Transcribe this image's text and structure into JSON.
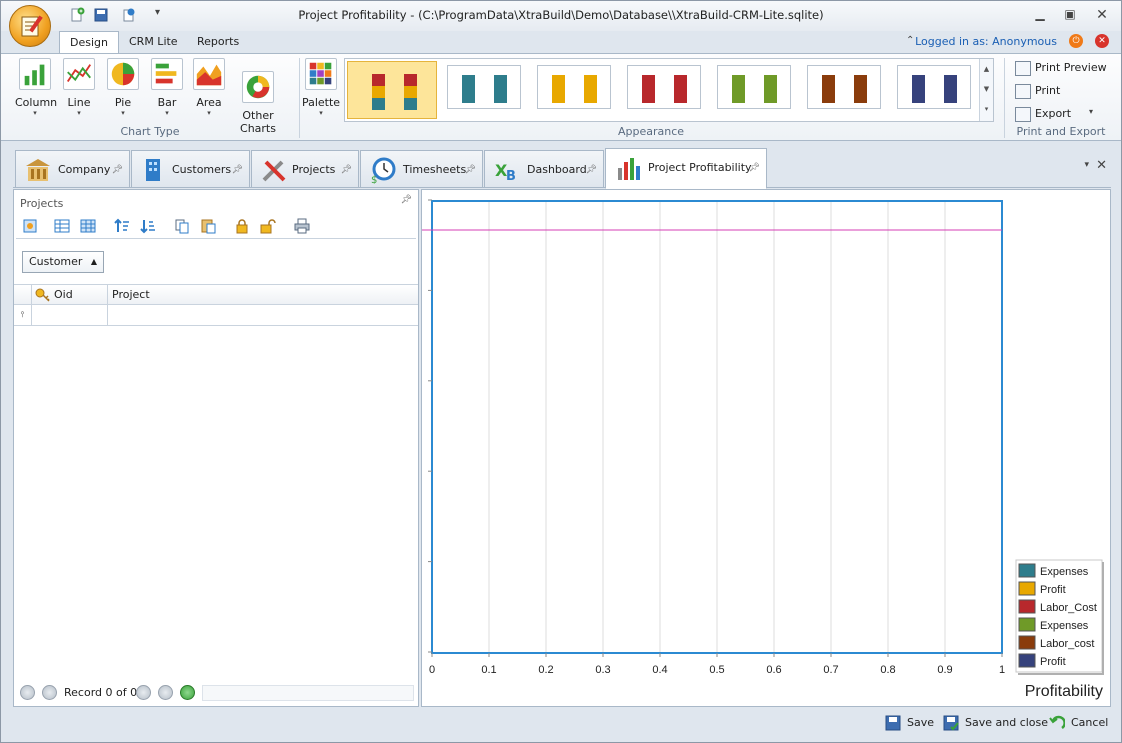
{
  "window": {
    "title": "Project Profitability -  (C:\\ProgramData\\XtraBuild\\Demo\\Database\\\\XtraBuild-CRM-Lite.sqlite)",
    "login_text": "Logged in as: Anonymous"
  },
  "ribbon": {
    "tabs": [
      "Design",
      "CRM Lite",
      "Reports"
    ],
    "chart_type": {
      "label": "Chart Type",
      "buttons": [
        "Column",
        "Line",
        "Pie",
        "Bar",
        "Area",
        "Other\nCharts"
      ]
    },
    "appearance": {
      "label": "Appearance",
      "palette_label": "Palette"
    },
    "print_export": {
      "label": "Print and Export",
      "buttons": [
        "Print Preview",
        "Print",
        "Export"
      ]
    }
  },
  "doc_tabs": [
    "Company",
    "Customers",
    "Projects",
    "Timesheets",
    "Dashboard",
    "Project Profitability"
  ],
  "projects_panel": {
    "title": "Projects",
    "group_by": "Customer",
    "columns": [
      "Oid",
      "Project"
    ],
    "record_text": "Record 0 of 0"
  },
  "chart_data": {
    "type": "bar",
    "title": "Profitability",
    "xlim": [
      0,
      1
    ],
    "x_ticks": [
      "0",
      "0.1",
      "0.2",
      "0.3",
      "0.4",
      "0.5",
      "0.6",
      "0.7",
      "0.8",
      "0.9",
      "1"
    ],
    "series": [
      {
        "name": "Expenses",
        "color": "#2e7d8c",
        "values": []
      },
      {
        "name": "Profit",
        "color": "#e8a800",
        "values": []
      },
      {
        "name": "Labor_Cost",
        "color": "#b8282c",
        "values": []
      },
      {
        "name": "Expenses",
        "color": "#6f9a28",
        "values": []
      },
      {
        "name": "Labor_cost",
        "color": "#8a3c0c",
        "values": []
      },
      {
        "name": "Profit",
        "color": "#36427c",
        "values": []
      }
    ],
    "grid": true,
    "legend_position": "bottom-right"
  },
  "status_bar": {
    "buttons": [
      "Save",
      "Save and close",
      "Cancel"
    ]
  },
  "colors": {
    "accent": "#1a5fb4",
    "plot_border": "#2b8ad2",
    "reference_line": "#d43fb5"
  }
}
